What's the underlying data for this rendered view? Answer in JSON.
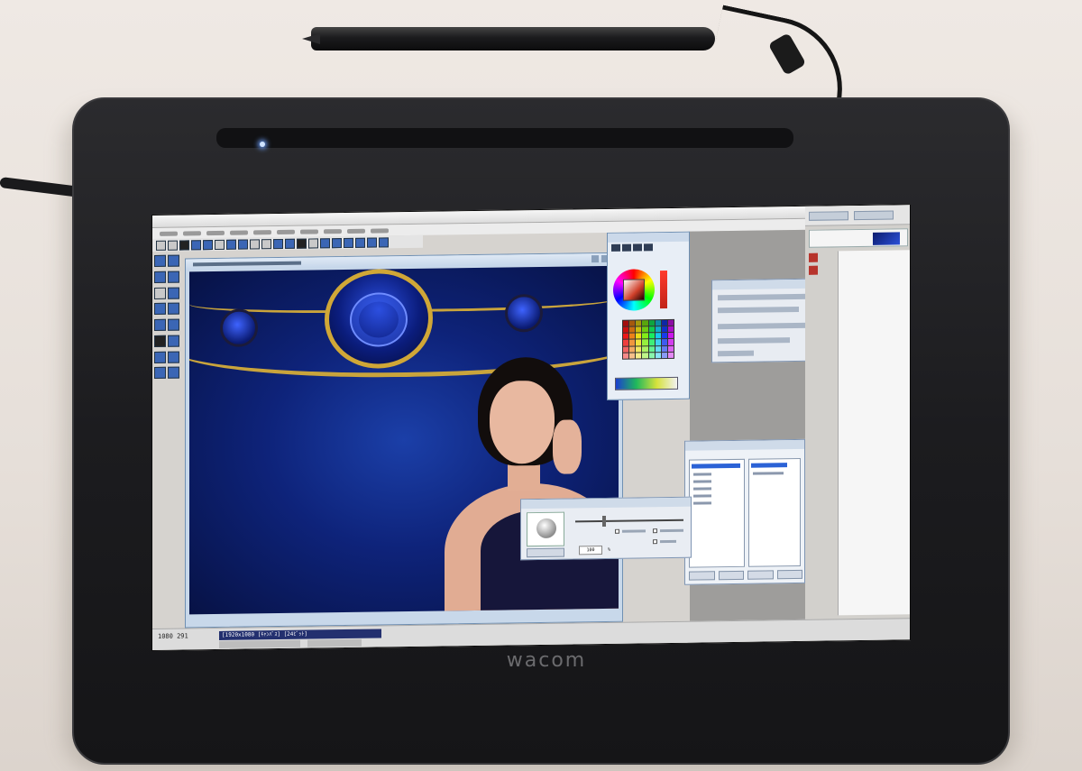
{
  "device": {
    "logo": "wacom"
  },
  "app": {
    "menu_count": 10,
    "toolbar_icons": [
      "new",
      "open",
      "save",
      "undo",
      "redo",
      "cut",
      "copy",
      "paste",
      "zoom-in",
      "zoom-out",
      "rotate",
      "flip",
      "select",
      "crop",
      "hand",
      "pen",
      "brush",
      "eraser",
      "fill",
      "color"
    ]
  },
  "status": {
    "coord": "1080 291",
    "doc_info": "[1920x1080 [ｷｬﾝﾊﾞｽ] [24ﾋﾞｯﾄ]"
  },
  "brush_dialog": {
    "zoom_value": "100",
    "zoom_unit": "%"
  },
  "colors": {
    "canvas_blue": "#0e237a",
    "gold": "#c9a43c",
    "selection_blue": "#2b62d6"
  }
}
